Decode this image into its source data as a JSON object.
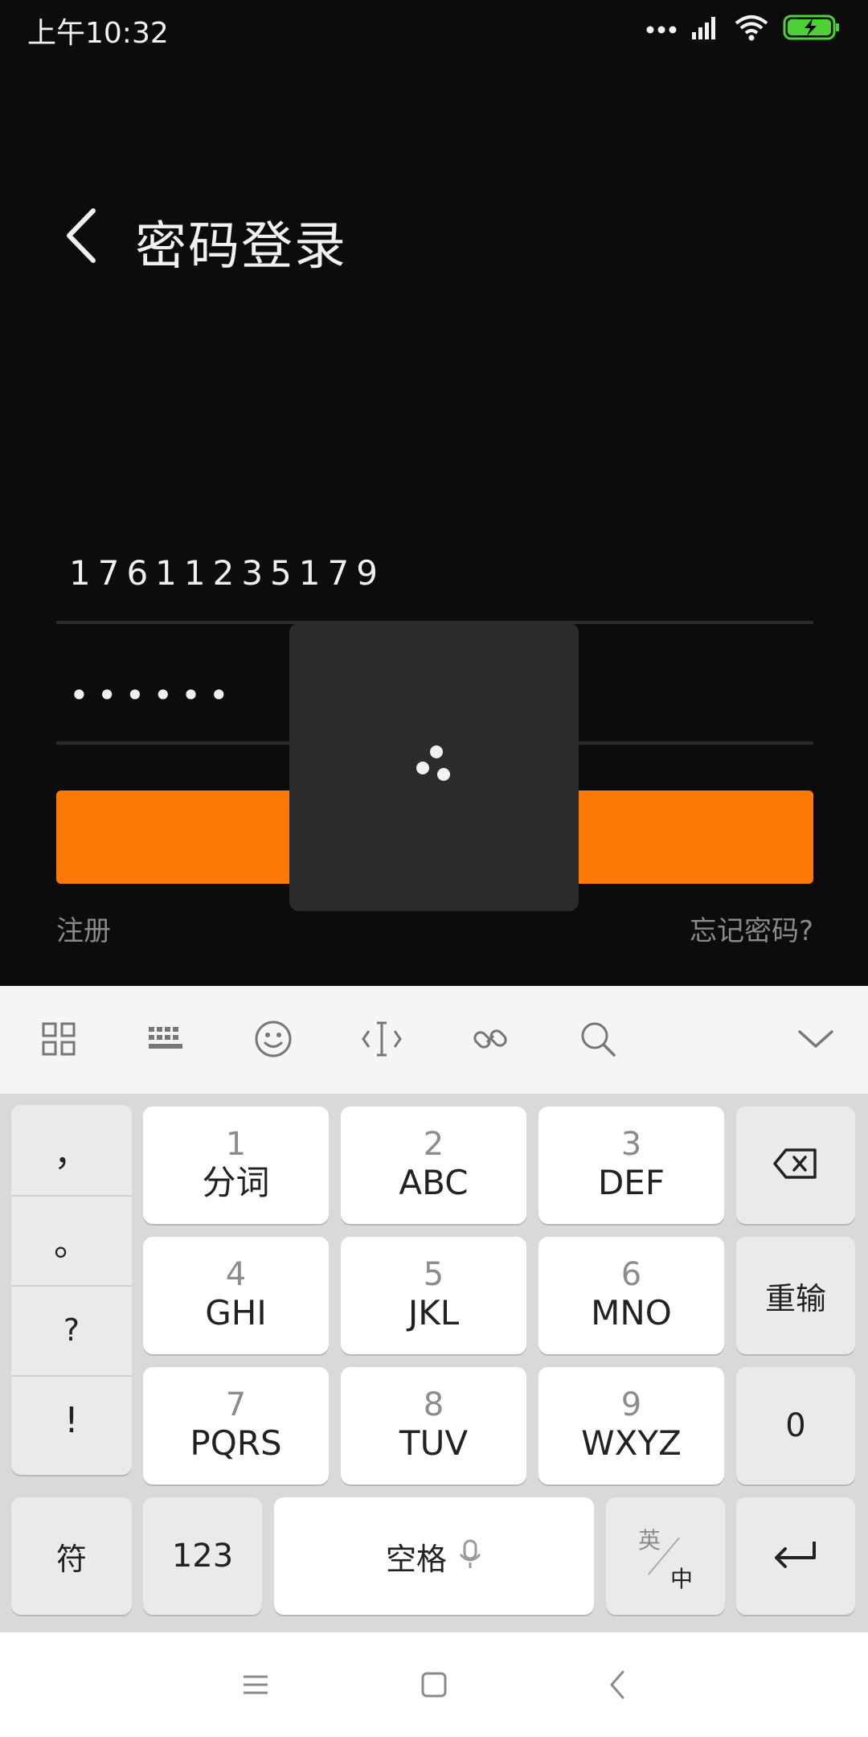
{
  "status_bar": {
    "time": "上午10:32",
    "icons": [
      "more-dots-icon",
      "signal-icon",
      "wifi-icon",
      "battery-charging-icon"
    ],
    "battery_color": "#4cd137"
  },
  "header": {
    "back_icon": "chevron-left-icon",
    "title": "密码登录"
  },
  "form": {
    "phone_value": "17611235179",
    "password_value": "••••••",
    "login_button_color": "#ff7a05",
    "register_label": "注册",
    "forgot_label": "忘记密码?"
  },
  "loading_overlay": {
    "icon": "loading-spinner-icon"
  },
  "keyboard_toolbar": {
    "icons": [
      "grid-icon",
      "keyboard-icon",
      "emoji-icon",
      "cursor-icon",
      "link-icon",
      "search-icon",
      "collapse-chevron-icon"
    ]
  },
  "keyboard": {
    "punctuation": [
      "，",
      "。",
      "?",
      "!"
    ],
    "keys": [
      {
        "num": "1",
        "letters": "分词"
      },
      {
        "num": "2",
        "letters": "ABC"
      },
      {
        "num": "3",
        "letters": "DEF"
      },
      {
        "num": "4",
        "letters": "GHI"
      },
      {
        "num": "5",
        "letters": "JKL"
      },
      {
        "num": "6",
        "letters": "MNO"
      },
      {
        "num": "7",
        "letters": "PQRS"
      },
      {
        "num": "8",
        "letters": "TUV"
      },
      {
        "num": "9",
        "letters": "WXYZ"
      }
    ],
    "retype": "重输",
    "zero": "0",
    "symbols": "符",
    "numbers": "123",
    "space": "空格",
    "lang_top": "英",
    "lang_bottom": "中"
  },
  "nav_bar": {
    "icons": [
      "menu-icon",
      "home-icon",
      "back-icon"
    ]
  }
}
